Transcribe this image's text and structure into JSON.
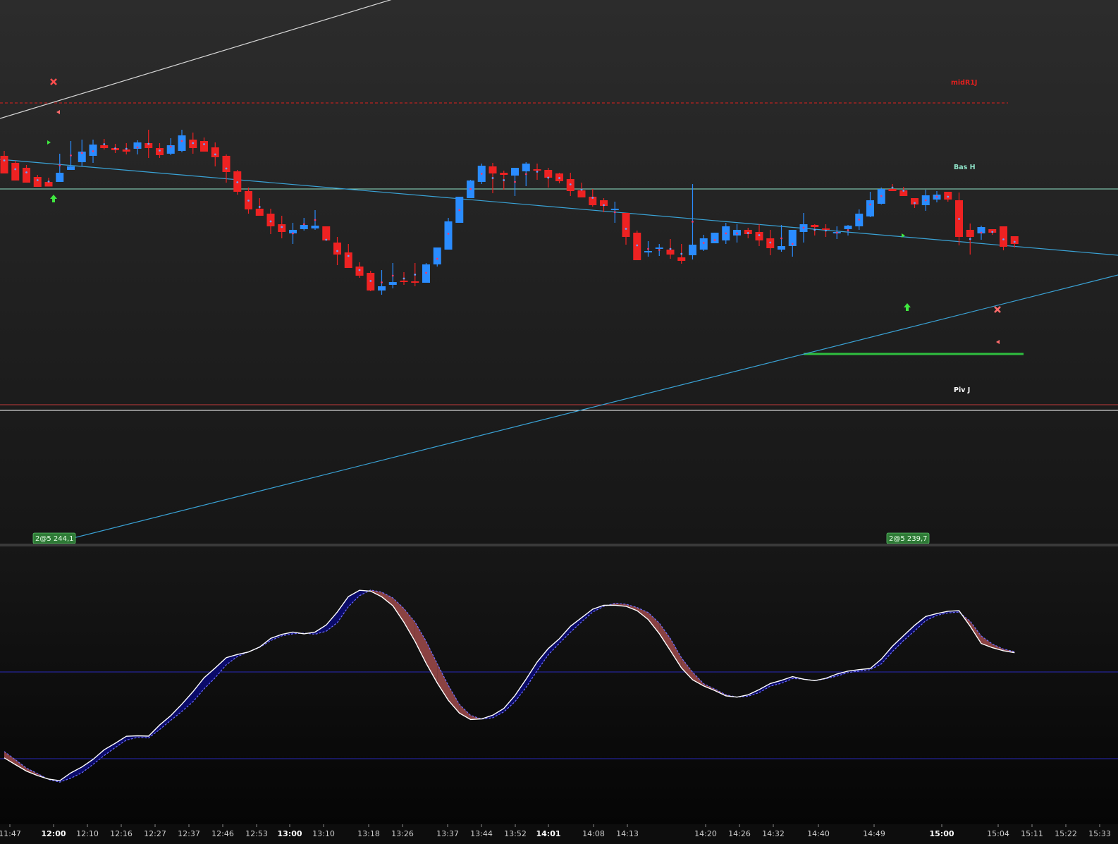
{
  "chart_data": {
    "type": "candlestick",
    "price_panel": {
      "candles": [
        [
          45.0,
          52.0,
          25.0,
          20.0
        ],
        [
          35.0,
          38.0,
          14.0,
          10.0
        ],
        [
          28.0,
          32.0,
          11.0,
          7.0
        ],
        [
          15.0,
          18.0,
          3.0,
          1.0
        ],
        [
          8.0,
          14.0,
          3.0,
          1.5
        ],
        [
          8.0,
          48.0,
          15.0,
          21.0
        ],
        [
          25.0,
          66.0,
          25.0,
          30.0
        ],
        [
          36.0,
          68.0,
          30.0,
          51.0
        ],
        [
          45.0,
          68.0,
          35.0,
          61.0
        ],
        [
          60.0,
          69.0,
          54.0,
          56.0
        ],
        [
          56.0,
          62.0,
          49.0,
          53.0
        ],
        [
          54.0,
          63.0,
          47.0,
          51.0
        ],
        [
          55.0,
          67.0,
          47.0,
          64.0
        ],
        [
          63.0,
          82.0,
          42.0,
          56.0
        ],
        [
          56.0,
          63.0,
          42.0,
          46.0
        ],
        [
          48.0,
          70.0,
          46.0,
          60.0
        ],
        [
          52.0,
          82.0,
          50.0,
          74.0
        ],
        [
          68.0,
          78.0,
          48.0,
          56.0
        ],
        [
          66.0,
          71.0,
          52.0,
          51.0
        ],
        [
          57.0,
          64.0,
          30.0,
          43.0
        ],
        [
          45.0,
          47.0,
          7.0,
          22.0
        ],
        [
          23.0,
          25.0,
          -10.0,
          -6.0
        ],
        [
          -5.0,
          0.0,
          -37.0,
          -31.0
        ],
        [
          -30.0,
          -15.0,
          -40.0,
          -40.0
        ],
        [
          -37.0,
          -30.0,
          -66.0,
          -55.0
        ],
        [
          -52.0,
          -40.0,
          -72.0,
          -63.0
        ],
        [
          -65.0,
          -50.0,
          -80.0,
          -60.0
        ],
        [
          -59.0,
          -43.0,
          -61.0,
          -53.0
        ],
        [
          -58.0,
          -32.0,
          -60.0,
          -54.0
        ],
        [
          -55.0,
          -73.0,
          -75.0,
          -75.0
        ],
        [
          -78.0,
          -70.0,
          -110.0,
          -95.0
        ],
        [
          -92.0,
          -80.0,
          -114.0,
          -114.0
        ],
        [
          -112.0,
          -106.0,
          -128.0,
          -125.0
        ],
        [
          -121.0,
          -118.0,
          -147.0,
          -146.0
        ],
        [
          -146.0,
          -117.0,
          -152.0,
          -140.0
        ],
        [
          -138.0,
          -107.0,
          -143.0,
          -134.0
        ],
        [
          -132.0,
          -120.0,
          -138.0,
          -134.0
        ],
        [
          -133.0,
          -107.0,
          -140.0,
          -135.0
        ],
        [
          -135.0,
          -107.0,
          -135.0,
          -109.0
        ],
        [
          -109.0,
          -90.0,
          -112.0,
          -85.0
        ],
        [
          -88.0,
          -43.0,
          -88.0,
          -48.0
        ],
        [
          -50.0,
          -14.0,
          -50.0,
          -13.0
        ],
        [
          -15.0,
          11.0,
          -15.0,
          10.0
        ],
        [
          8.0,
          34.0,
          5.0,
          31.0
        ],
        [
          30.0,
          35.0,
          -8.0,
          20.0
        ],
        [
          21.0,
          24.0,
          -3.0,
          18.0
        ],
        [
          17.0,
          28.0,
          -12.0,
          28.0
        ],
        [
          23.0,
          36.0,
          2.0,
          34.0
        ],
        [
          26.0,
          34.0,
          11.0,
          24.0
        ],
        [
          25.0,
          28.0,
          -0.0,
          14.0
        ],
        [
          20.0,
          21.0,
          6.0,
          9.0
        ],
        [
          12.0,
          21.0,
          -12.0,
          -5.0
        ],
        [
          -4.0,
          7.0,
          -13.0,
          -14.0
        ],
        [
          -13.0,
          -2.0,
          -27.0,
          -25.0
        ],
        [
          -18.0,
          -15.0,
          -35.0,
          -26.0
        ],
        [
          -30.0,
          -20.0,
          -50.0,
          -30.0
        ],
        [
          -36.0,
          -36.0,
          -81.0,
          -70.0
        ],
        [
          -64.0,
          -61.0,
          -103.0,
          -103.0
        ],
        [
          -92.0,
          -76.0,
          -98.0,
          -90.0
        ],
        [
          -87.0,
          -80.0,
          -97.0,
          -85.0
        ],
        [
          -88.0,
          -73.0,
          -101.0,
          -95.0
        ],
        [
          -99.0,
          -80.0,
          -108.0,
          -104.0
        ],
        [
          -96.0,
          5.0,
          -102.0,
          -81.0
        ],
        [
          -88.0,
          -67.0,
          -90.0,
          -72.0
        ],
        [
          -79.0,
          -70.0,
          -79.0,
          -64.0
        ],
        [
          -75.0,
          -50.0,
          -80.0,
          -55.0
        ],
        [
          -68.0,
          -52.0,
          -78.0,
          -60.0
        ],
        [
          -60.0,
          -57.0,
          -72.0,
          -66.0
        ],
        [
          -63.0,
          -52.0,
          -83.0,
          -75.0
        ],
        [
          -72.0,
          -60.0,
          -96.0,
          -86.0
        ],
        [
          -88.0,
          -53.0,
          -91.0,
          -83.0
        ],
        [
          -83.0,
          -62.0,
          -98.0,
          -60.0
        ],
        [
          -63.0,
          -36.0,
          -78.0,
          -52.0
        ],
        [
          -53.0,
          -52.0,
          -68.0,
          -56.0
        ],
        [
          -58.0,
          -52.0,
          -70.0,
          -60.0
        ],
        [
          -63.0,
          -55.0,
          -73.0,
          -63.0
        ],
        [
          -59.0,
          -53.0,
          -68.0,
          -54.0
        ],
        [
          -55.0,
          -31.0,
          -60.0,
          -37.0
        ],
        [
          -41.0,
          -6.0,
          -42.0,
          -18.0
        ],
        [
          -23.0,
          0.0,
          -24.0,
          -2.0
        ],
        [
          -2.0,
          5.0,
          -5.0,
          -5.0
        ],
        [
          -4.0,
          1.0,
          -10.0,
          -12.0
        ],
        [
          -15.0,
          -15.0,
          -29.0,
          -24.0
        ],
        [
          -25.0,
          -3.0,
          -33.0,
          -11.0
        ],
        [
          -17.0,
          -5.0,
          -21.0,
          -10.0
        ],
        [
          -6.0,
          -6.0,
          -20.0,
          -17.0
        ],
        [
          -18.0,
          -7.0,
          -82.0,
          -70.0
        ],
        [
          -60.0,
          -51.0,
          -95.0,
          -70.0
        ],
        [
          -65.0,
          -54.0,
          -74.0,
          -56.0
        ],
        [
          -59.0,
          -59.0,
          -67.0,
          -64.0
        ],
        [
          -55.0,
          -58.0,
          -89.0,
          -84.0
        ],
        [
          -69.0,
          -69.0,
          -85.0,
          -80.0
        ]
      ],
      "levels": [
        {
          "label": "midR1J",
          "color": "#e0201e",
          "style": "dashed"
        },
        {
          "label": "Bas H",
          "color": "#8fe3c8",
          "style": "solid"
        },
        {
          "label": "Piv J",
          "color": "#ffffff",
          "style": "solid"
        }
      ],
      "order_badges": [
        {
          "label": "2@5 244,1"
        },
        {
          "label": "2@5 239,7"
        }
      ]
    },
    "oscillator_panel": {
      "series": [
        {
          "values": [
            20.6,
            15.9,
            11.4,
            8.3,
            5.9,
            4.8,
            10.2,
            14.3,
            19.5,
            26.2,
            30.7,
            35.5,
            35.8,
            35.6,
            43.3,
            49.8,
            57.7,
            66.4,
            76.0,
            82.8,
            89.9,
            92.1,
            93.8,
            97.2,
            103.2,
            106.0,
            107.6,
            106.4,
            107.6,
            112.5,
            121.5,
            132.2,
            136.5,
            135.9,
            132.0,
            125.8,
            114.4,
            101.1,
            86.0,
            72.4,
            60.4,
            51.5,
            47.1,
            47.5,
            50.1,
            54.8,
            63.7,
            75.0,
            86.9,
            96.2,
            103.0,
            111.6,
            117.5,
            123.4,
            126.1,
            126.2,
            125.4,
            122.4,
            116.3,
            106.5,
            94.8,
            82.7,
            74.6,
            70.3,
            67.1,
            63.4,
            62.6,
            64.2,
            67.8,
            72.0,
            74.2,
            76.8,
            75.0,
            74.0,
            75.6,
            78.6,
            80.6,
            81.6,
            82.4,
            88.9,
            97.8,
            105.1,
            112.3,
            118.4,
            120.4,
            122.0,
            122.4,
            111.6,
            99.7,
            96.8,
            94.7,
            93.3
          ]
        },
        {
          "values": [
            25.0,
            19.3,
            13.5,
            9.7,
            5.6,
            3.8,
            6.5,
            10.3,
            16.0,
            22.2,
            27.7,
            32.9,
            34.7,
            34.3,
            40.2,
            46.6,
            52.7,
            59.4,
            68.3,
            76.0,
            85.0,
            90.7,
            93.9,
            97.0,
            101.7,
            105.0,
            106.4,
            106.9,
            106.1,
            108.2,
            114.1,
            125.2,
            132.8,
            136.7,
            135.2,
            131.2,
            123.9,
            114.5,
            101.2,
            85.7,
            70.7,
            57.5,
            50.0,
            47.4,
            48.3,
            52.4,
            59.4,
            69.3,
            80.9,
            91.9,
            99.8,
            107.5,
            114.7,
            121.4,
            125.4,
            127.5,
            126.9,
            124.6,
            121.1,
            113.8,
            103.1,
            89.7,
            79.9,
            71.8,
            68.2,
            64.2,
            62.6,
            63.2,
            65.7,
            70.2,
            72.2,
            75.4,
            75.1,
            74.0,
            75.3,
            77.1,
            79.6,
            80.6,
            81.6,
            85.5,
            94.1,
            101.7,
            108.4,
            115.5,
            119.1,
            120.9,
            121.4,
            115.1,
            104.9,
            99.3,
            95.8,
            94.1
          ]
        }
      ],
      "ylim": [
        0,
        140
      ],
      "levels": [
        80,
        20
      ]
    },
    "x_axis": {
      "tick_labels": [
        {
          "text": "11:47",
          "major": false
        },
        {
          "text": "12:00",
          "major": true
        },
        {
          "text": "12:10",
          "major": false
        },
        {
          "text": "12:16",
          "major": false
        },
        {
          "text": "12:27",
          "major": false
        },
        {
          "text": "12:37",
          "major": false
        },
        {
          "text": "12:46",
          "major": false
        },
        {
          "text": "12:53",
          "major": false
        },
        {
          "text": "13:00",
          "major": true
        },
        {
          "text": "13:10",
          "major": false
        },
        {
          "text": "13:18",
          "major": false
        },
        {
          "text": "13:26",
          "major": false
        },
        {
          "text": "13:37",
          "major": false
        },
        {
          "text": "13:44",
          "major": false
        },
        {
          "text": "13:52",
          "major": false
        },
        {
          "text": "14:01",
          "major": true
        },
        {
          "text": "14:08",
          "major": false
        },
        {
          "text": "14:13",
          "major": false
        },
        {
          "text": "14:20",
          "major": false
        },
        {
          "text": "14:26",
          "major": false
        },
        {
          "text": "14:32",
          "major": false
        },
        {
          "text": "14:40",
          "major": false
        },
        {
          "text": "14:49",
          "major": false
        },
        {
          "text": "15:00",
          "major": true
        },
        {
          "text": "15:04",
          "major": false
        },
        {
          "text": "15:11",
          "major": false
        },
        {
          "text": "15:22",
          "major": false
        },
        {
          "text": "15:33",
          "major": false
        }
      ]
    },
    "colors": {
      "bull": "#2a8cff",
      "bear": "#ee2222",
      "osc_fast": "#ffffff",
      "osc_slow": "#6d6dff",
      "fill_up": "#0a0a6a",
      "fill_down": "#8a4242",
      "trendline": "#3aa3d6",
      "osc_level": "#2828b8"
    }
  }
}
